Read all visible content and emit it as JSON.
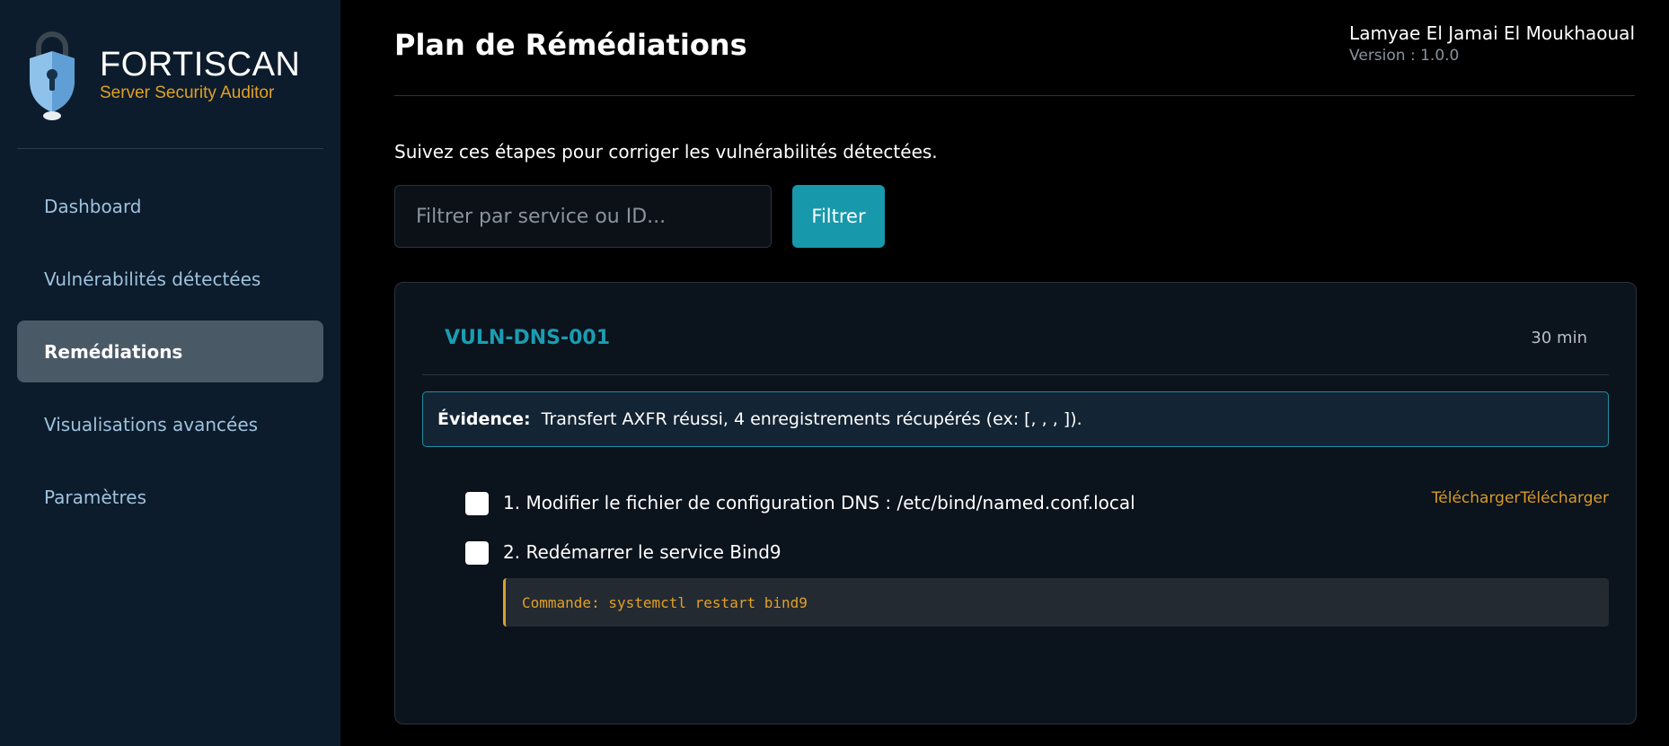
{
  "brand": {
    "name": "FORTISCAN",
    "subtitle": "Server Security Auditor"
  },
  "sidebar": {
    "items": [
      {
        "label": "Dashboard",
        "active": false
      },
      {
        "label": "Vulnérabilités détectées",
        "active": false
      },
      {
        "label": "Remédiations",
        "active": true
      },
      {
        "label": "Visualisations avancées",
        "active": false
      },
      {
        "label": "Paramètres",
        "active": false
      }
    ]
  },
  "header": {
    "title": "Plan de Réméd­iations",
    "user_name": "Lamyae El Jamai El Moukhaoual",
    "version": "Version : 1.0.0"
  },
  "main": {
    "intro": "Suivez ces étapes pour corriger les vulnérabilités détectées.",
    "filter": {
      "placeholder": "Filtrer par service ou ID...",
      "value": "",
      "button_label": "Filtrer"
    },
    "card": {
      "id": "VULN-DNS-001",
      "duration": "30 min",
      "evidence_label": "Évidence:",
      "evidence_text": "Transfert AXFR réussi, 4 enregistrements récupérés (ex: [, , , ]).",
      "steps": [
        {
          "text": "1. Modifier le fichier de configuration DNS : /etc/bind/named.conf.local",
          "checked": false,
          "download_label": "TéléchargerTélécharger"
        },
        {
          "text": "2. Redémarrer le service Bind9",
          "checked": false,
          "command": "Commande: systemctl restart bind9"
        }
      ]
    }
  },
  "colors": {
    "accent": "#1798ab",
    "brand_sub": "#e2a025",
    "sidebar_bg": "#0c1c2c",
    "active_nav": "#4a5966",
    "link": "#d89a28"
  },
  "icons": {
    "logo": "shield-lock-icon"
  }
}
